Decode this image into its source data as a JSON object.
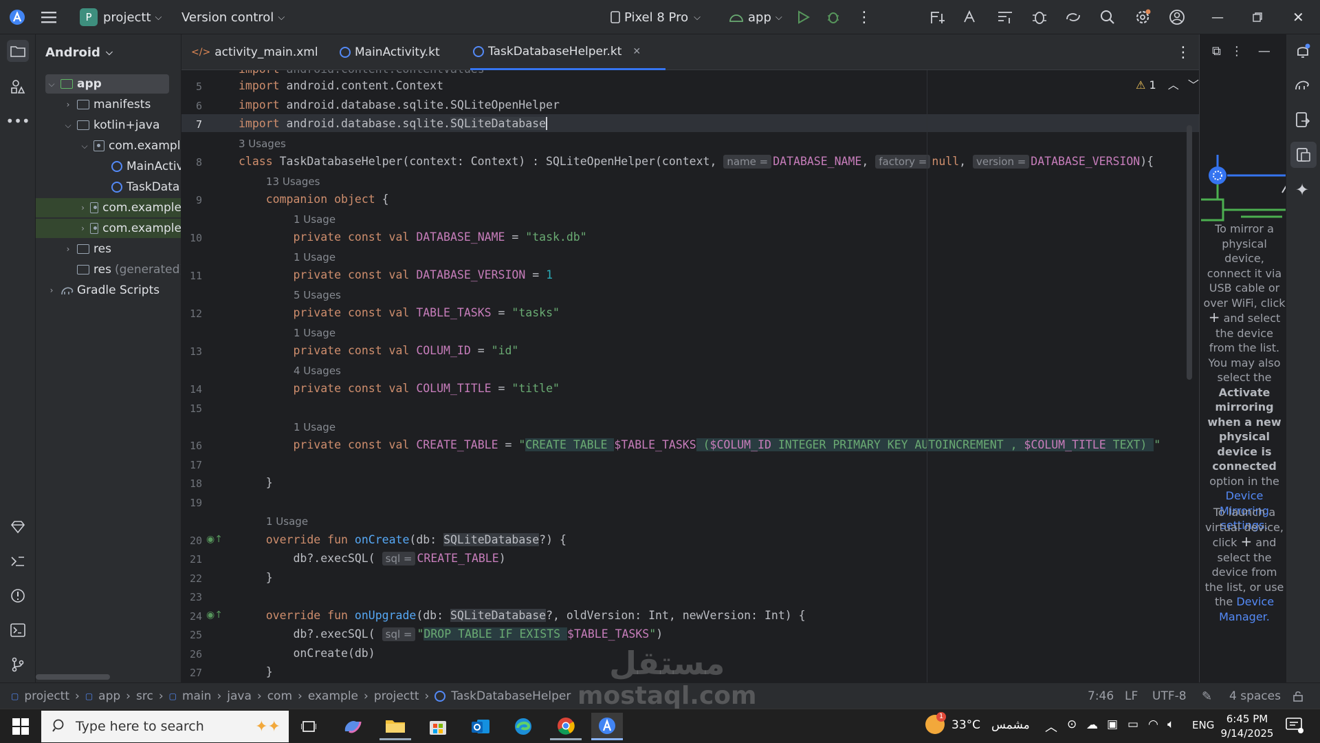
{
  "titlebar": {
    "project_initial": "P",
    "project_name": "projectt",
    "vcs": "Version control",
    "device": "Pixel 8 Pro",
    "run_config": "app"
  },
  "project_panel": {
    "view": "Android",
    "tree": [
      {
        "label": "app"
      },
      {
        "label": "manifests"
      },
      {
        "label": "kotlin+java"
      },
      {
        "label": "com.example"
      },
      {
        "label": "MainActiv"
      },
      {
        "label": "TaskData"
      },
      {
        "label": "com.example"
      },
      {
        "label": "com.example"
      },
      {
        "label": "res"
      },
      {
        "label": "res",
        "suffix": "(generated)"
      },
      {
        "label": "Gradle Scripts"
      }
    ]
  },
  "tabs": [
    {
      "label": "activity_main.xml"
    },
    {
      "label": "MainActivity.kt"
    },
    {
      "label": "TaskDatabaseHelper.kt",
      "active": true
    }
  ],
  "editor": {
    "warning_count": "1",
    "line_numbers": [
      "5",
      "6",
      "7",
      "8",
      "9",
      "10",
      "11",
      "12",
      "13",
      "14",
      "15",
      "16",
      "17",
      "18",
      "19",
      "20",
      "21",
      "22",
      "23",
      "24",
      "25",
      "26",
      "27"
    ],
    "usages": {
      "u_class": "3 Usages",
      "u_companion": "13 Usages",
      "u_dbname": "1 Usage",
      "u_dbver": "1 Usage",
      "u_table": "5 Usages",
      "u_colid": "1 Usage",
      "u_coltitle": "4 Usages",
      "u_create": "1 Usage",
      "u_oncreate": "1 Usage"
    },
    "hints": {
      "name": "name =",
      "factory": "factory =",
      "version": "version =",
      "sql": "sql ="
    }
  },
  "right_panel": {
    "mirror_text_1": "To mirror a physical device, connect it via USB cable or over WiFi, click",
    "mirror_text_2": "and select the device from the list. You may also select the",
    "mirror_bold": "Activate mirroring when a new physical device is connected",
    "mirror_text_3": "option in the",
    "mirror_link": "Device Mirroring settings.",
    "launch_text_1": "To launch a virtual device, click",
    "launch_text_2": "and select the device from the list, or use the",
    "launch_link": "Device Manager."
  },
  "statusbar": {
    "breadcrumbs": [
      "projectt",
      "app",
      "src",
      "main",
      "java",
      "com",
      "example",
      "projectt",
      "TaskDatabaseHelper"
    ],
    "position": "7:46",
    "line_sep": "LF",
    "encoding": "UTF-8",
    "indent": "4 spaces"
  },
  "taskbar": {
    "search_placeholder": "Type here to search",
    "temperature": "33°C",
    "weather": "مشمس",
    "weather_badge": "1",
    "lang": "ENG",
    "time": "6:45 PM",
    "date": "9/14/2025"
  },
  "watermark": {
    "line1": "مستقل",
    "line2": "mostaql.com"
  },
  "colors": {
    "accent": "#3574f0",
    "keyword": "#cf8e6d",
    "string": "#6aab73",
    "constant": "#c77dbb",
    "function": "#56a8f5"
  }
}
